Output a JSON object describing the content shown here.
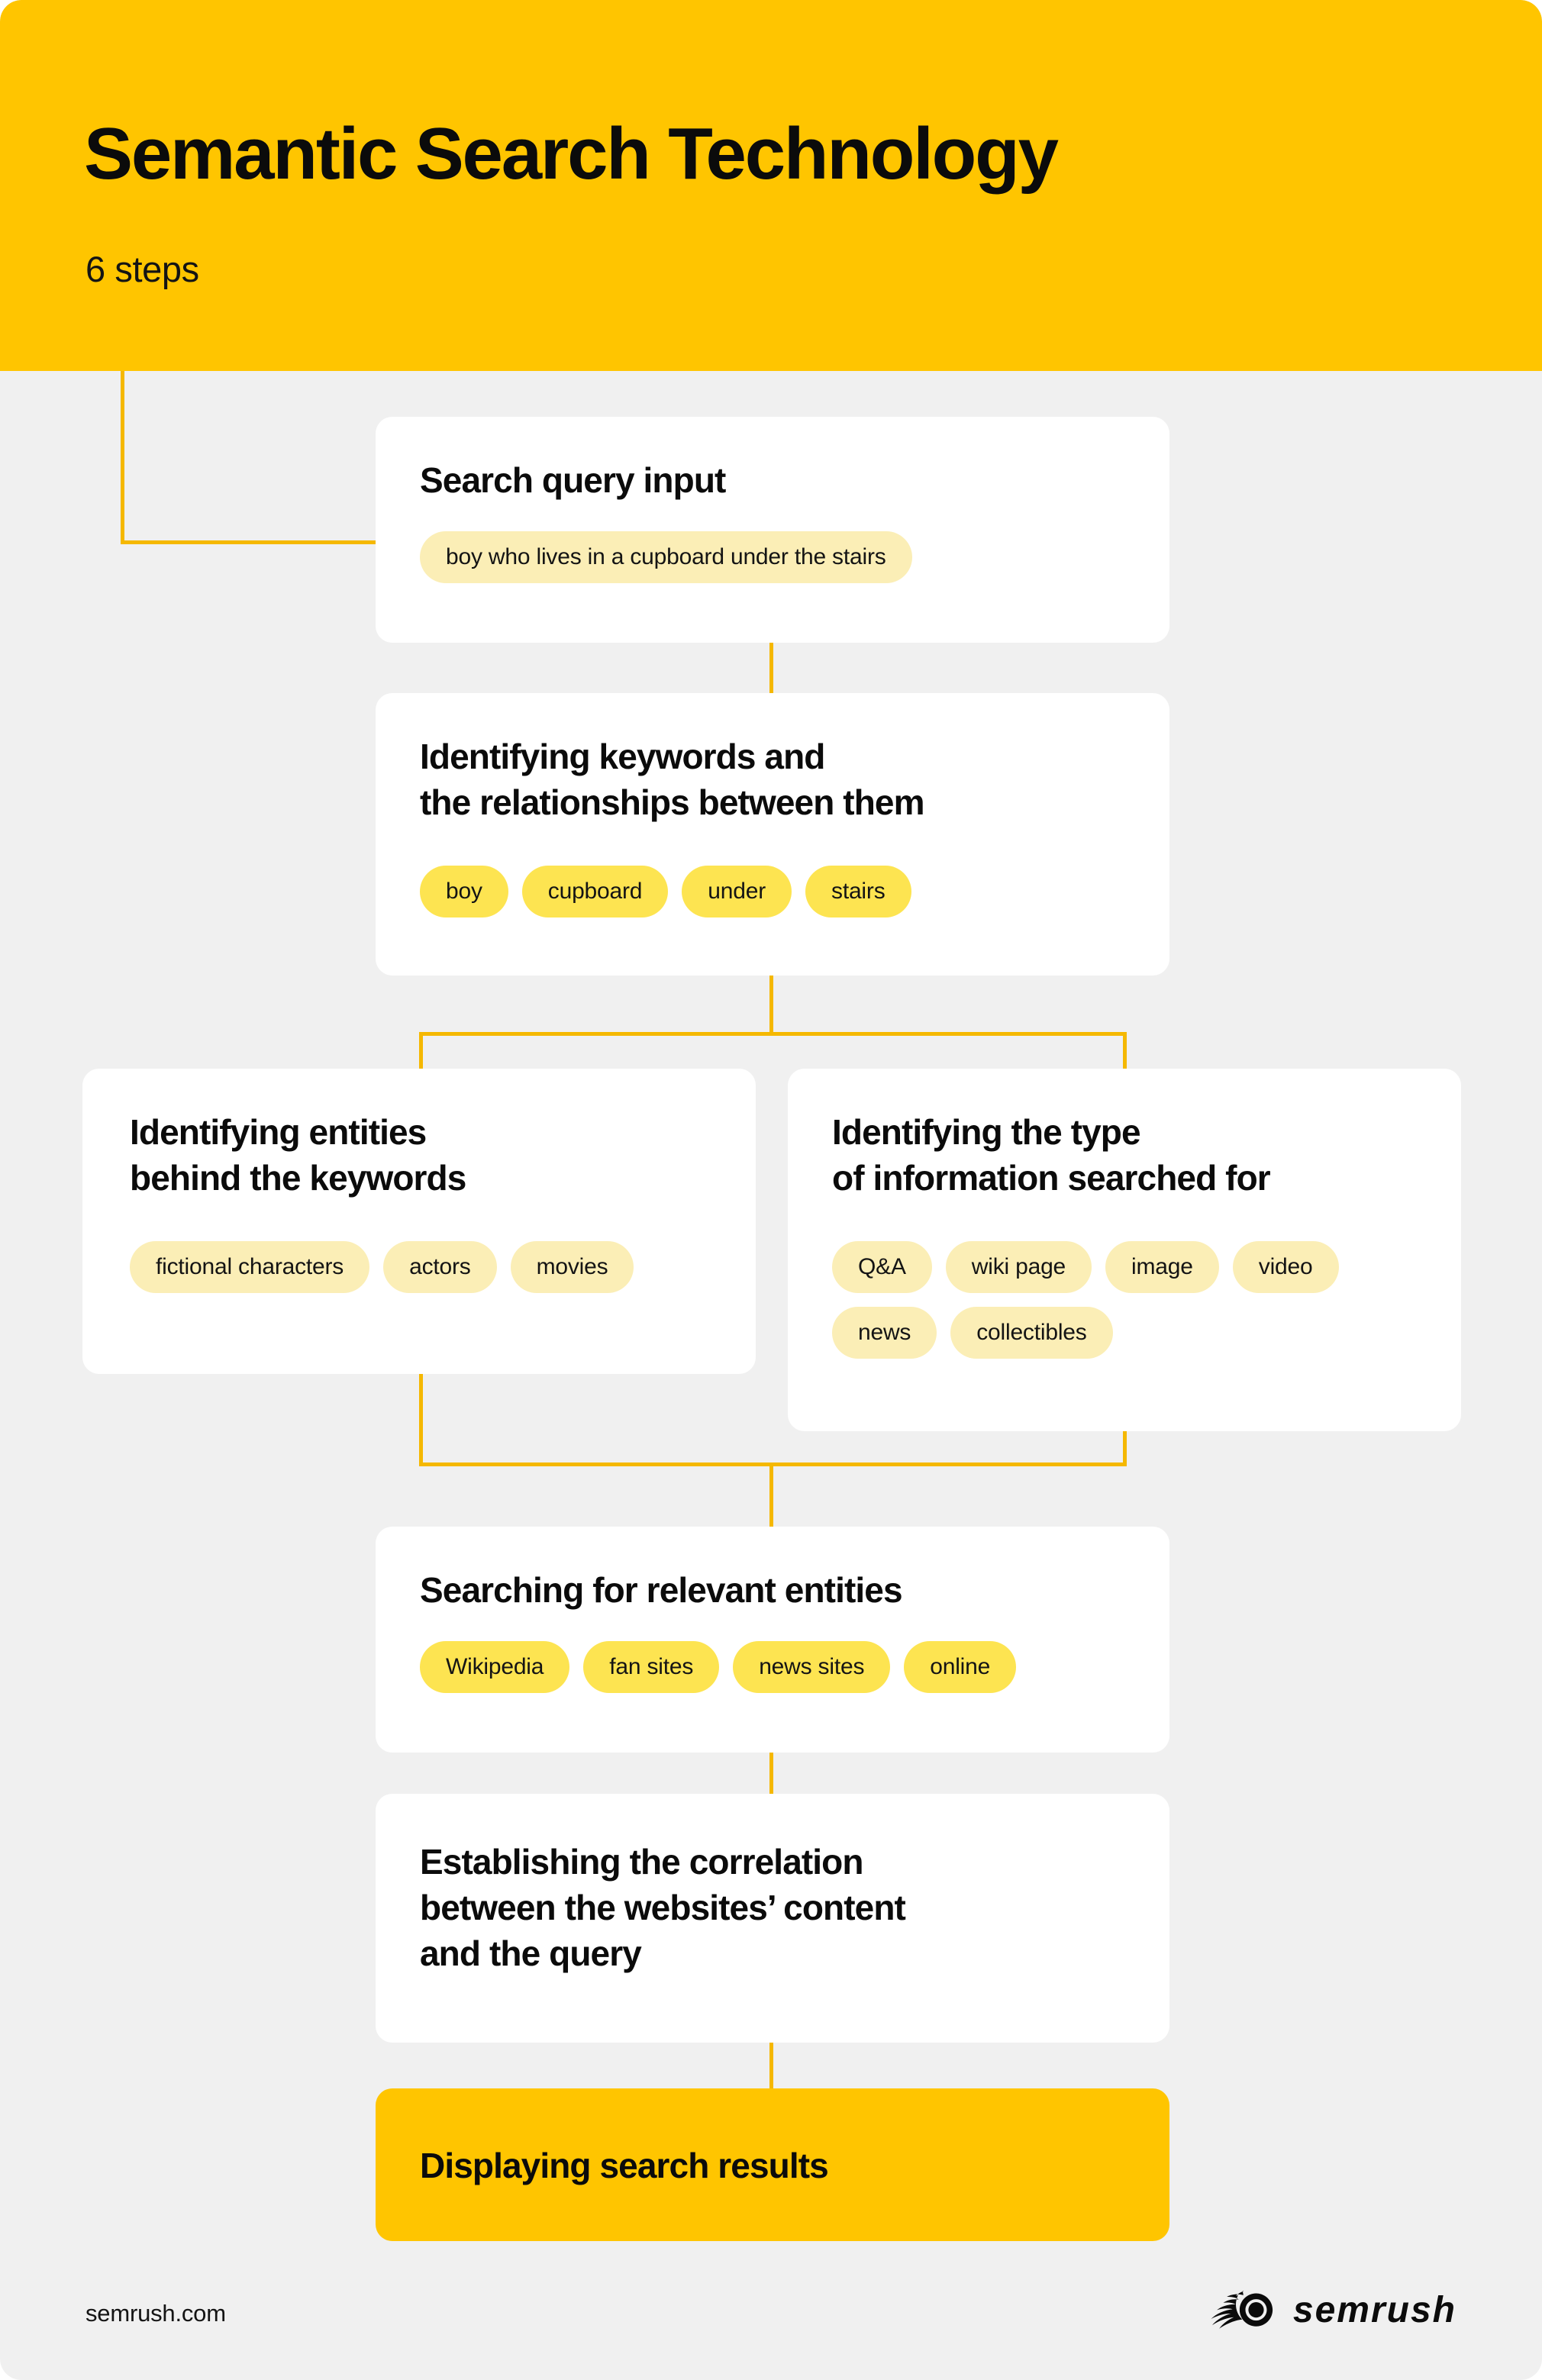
{
  "header": {
    "title": "Semantic Search Technology",
    "subtitle": "6 steps"
  },
  "colors": {
    "brand_yellow": "#FFC500",
    "page_background": "#F0F0F0",
    "card_background": "#FFFFFF",
    "connector_line": "#F5B800",
    "pill_cream": "#FBEEB6",
    "pill_bright": "#FDE451",
    "text_primary": "#0B0B0B"
  },
  "steps": [
    {
      "id": "search-query-input",
      "title": "Search query input",
      "pill_style": "cream",
      "pills": [
        "boy who lives in a cupboard under the stairs"
      ]
    },
    {
      "id": "identifying-keywords",
      "title": "Identifying keywords and\nthe relationships between them",
      "pill_style": "bright",
      "pills": [
        "boy",
        "cupboard",
        "under",
        "stairs"
      ]
    },
    {
      "id": "identifying-entities",
      "title": "Identifying entities\nbehind the keywords",
      "pill_style": "cream",
      "pills": [
        "fictional characters",
        "actors",
        "movies"
      ]
    },
    {
      "id": "identifying-information-type",
      "title": "Identifying the type\nof information searched for",
      "pill_style": "cream",
      "pills": [
        "Q&A",
        "wiki page",
        "image",
        "video",
        "news",
        "collectibles"
      ]
    },
    {
      "id": "searching-relevant-entities",
      "title": "Searching for relevant entities",
      "pill_style": "bright",
      "pills": [
        "Wikipedia",
        "fan sites",
        "news sites",
        "online"
      ]
    },
    {
      "id": "establishing-correlation",
      "title": "Establishing the correlation\nbetween the websites’ content\nand the query",
      "pill_style": "none",
      "pills": []
    },
    {
      "id": "displaying-search-results",
      "title": "Displaying search results",
      "pill_style": "none",
      "pills": []
    }
  ],
  "footer": {
    "url": "semrush.com",
    "logo_wordmark": "semrush",
    "logo_icon": "semrush-comet-icon"
  }
}
